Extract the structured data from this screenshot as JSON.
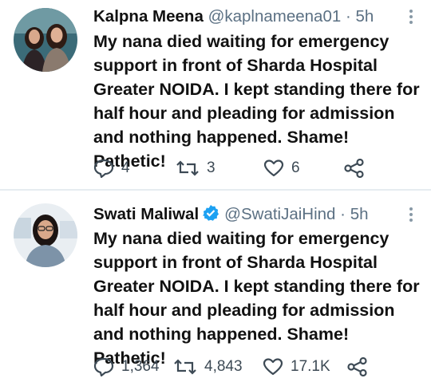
{
  "tweets": [
    {
      "display_name": "Kalpna Meena",
      "handle": "@kaplnameena01",
      "separator": "·",
      "time": "5h",
      "verified": false,
      "text": "My nana died waiting for emergency\nsupport in front of Sharda Hospital\nGreater NOIDA. I kept standing there for\nhalf hour and pleading for admission\nand nothing happened. Shame! Pathetic!",
      "replies": "4",
      "retweets": "3",
      "likes": "6"
    },
    {
      "display_name": "Swati Maliwal",
      "handle": "@SwatiJaiHind",
      "separator": "·",
      "time": "5h",
      "verified": true,
      "text": "My nana died waiting for emergency\nsupport in front of Sharda Hospital\nGreater NOIDA. I kept standing there for\nhalf hour and pleading for admission\nand nothing happened. Shame! Pathetic!",
      "replies": "1,364",
      "retweets": "4,843",
      "likes": "17.1K"
    }
  ],
  "icons": {
    "reply": "reply-icon",
    "retweet": "retweet-icon",
    "like": "heart-icon",
    "share": "share-icon",
    "more": "more-icon",
    "verified": "verified-badge-icon"
  },
  "colors": {
    "verified": "#1da1f2",
    "meta": "#5b7083",
    "divider": "#e6ecf0"
  }
}
